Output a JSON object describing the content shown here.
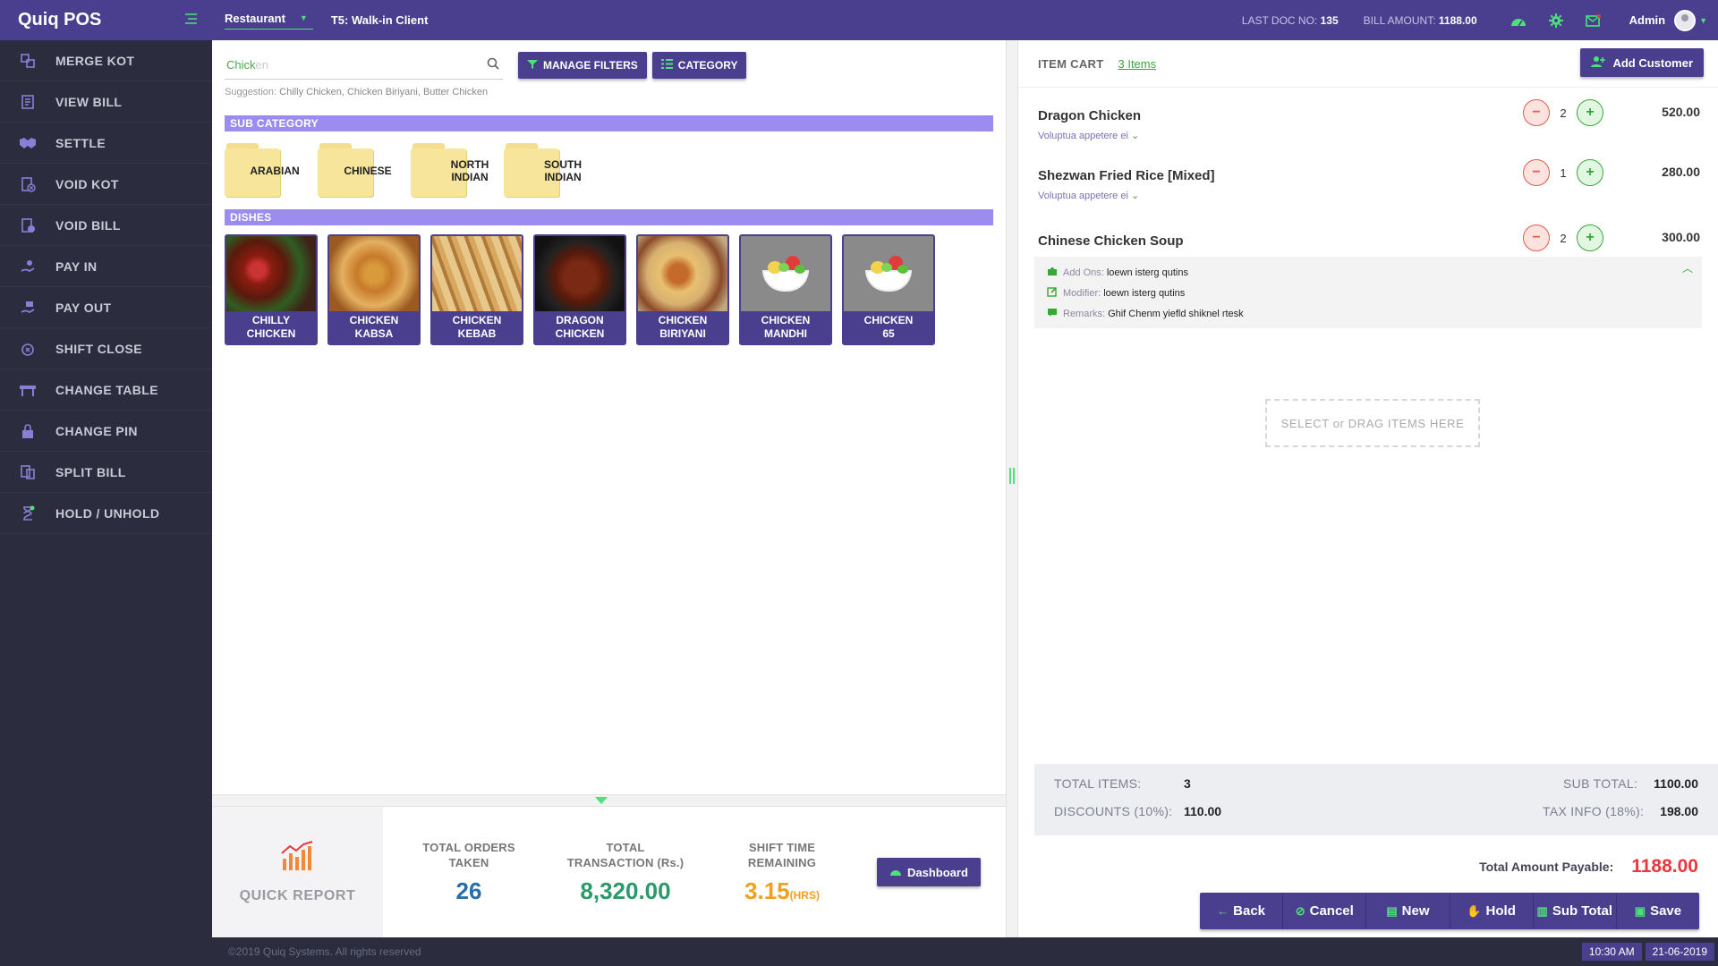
{
  "app": {
    "title": "Quiq POS"
  },
  "sidebar": {
    "items": [
      {
        "label": "MERGE KOT",
        "icon": "merge-icon"
      },
      {
        "label": "VIEW BILL",
        "icon": "bill-icon"
      },
      {
        "label": "SETTLE",
        "icon": "handshake-icon"
      },
      {
        "label": "VOID KOT",
        "icon": "void-kot-icon"
      },
      {
        "label": "VOID BILL",
        "icon": "void-bill-icon"
      },
      {
        "label": "PAY IN",
        "icon": "pay-in-icon"
      },
      {
        "label": "PAY OUT",
        "icon": "pay-out-icon"
      },
      {
        "label": "SHIFT CLOSE",
        "icon": "shift-close-icon"
      },
      {
        "label": "CHANGE TABLE",
        "icon": "table-icon"
      },
      {
        "label": "CHANGE PIN",
        "icon": "lock-icon"
      },
      {
        "label": "SPLIT BILL",
        "icon": "split-icon"
      },
      {
        "label": "HOLD / UNHOLD",
        "icon": "hourglass-icon"
      }
    ]
  },
  "topbar": {
    "mode": "Restaurant",
    "client": "T5: Walk-in Client",
    "last_doc_label": "LAST DOC NO:",
    "last_doc_value": "135",
    "bill_amount_label": "BILL AMOUNT:",
    "bill_amount_value": "1188.00",
    "user": "Admin"
  },
  "search": {
    "value": "Chick",
    "placeholder": "Chicken",
    "manage_filters": "MANAGE FILTERS",
    "category": "CATEGORY",
    "suggestion_label": "Suggestion:",
    "suggestion_text": "Chilly Chicken, Chicken Biriyani, Butter Chicken"
  },
  "sub_category": {
    "title": "SUB CATEGORY",
    "items": [
      {
        "label": "ARABIAN"
      },
      {
        "label": "CHINESE"
      },
      {
        "label": "NORTH INDIAN"
      },
      {
        "label": "SOUTH INDIAN"
      }
    ]
  },
  "dishes": {
    "title": "DISHES",
    "items": [
      {
        "label": "CHILLY CHICKEN"
      },
      {
        "label": "CHICKEN KABSA"
      },
      {
        "label": "CHICKEN KEBAB"
      },
      {
        "label": "DRAGON CHICKEN"
      },
      {
        "label": "CHICKEN BIRIYANI"
      },
      {
        "label": "CHICKEN MANDHI"
      },
      {
        "label": "CHICKEN 65"
      }
    ]
  },
  "quick_report": {
    "title": "QUICK REPORT",
    "orders_label": "TOTAL ORDERS TAKEN",
    "orders_value": "26",
    "transaction_label": "TOTAL TRANSACTION (Rs.)",
    "transaction_value": "8,320.00",
    "shift_label": "SHIFT TIME REMAINING",
    "shift_value": "3.15",
    "shift_unit": "(HRS)",
    "dashboard": "Dashboard"
  },
  "cart": {
    "title": "ITEM CART",
    "count": "3 Items",
    "add_customer": "Add Customer",
    "items": [
      {
        "name": "Dragon Chicken",
        "sub": "Voluptua appetere ei",
        "qty": "2",
        "price": "520.00"
      },
      {
        "name": "Shezwan Fried Rice [Mixed]",
        "sub": "Voluptua appetere ei",
        "qty": "1",
        "price": "280.00"
      },
      {
        "name": "Chinese Chicken Soup",
        "sub": "",
        "qty": "2",
        "price": "300.00"
      }
    ],
    "details": {
      "addons_label": "Add Ons:",
      "addons_value": "loewn isterg qutins",
      "modifier_label": "Modifier:",
      "modifier_value": "loewn isterg qutins",
      "remarks_label": "Remarks:",
      "remarks_value": "Ghif Chenm yiefld shiknel rtesk"
    },
    "drop_zone": "SELECT or DRAG ITEMS HERE"
  },
  "summary": {
    "total_items_label": "TOTAL ITEMS:",
    "total_items_value": "3",
    "discounts_label": "DISCOUNTS (10%):",
    "discounts_value": "110.00",
    "sub_total_label": "SUB TOTAL:",
    "sub_total_value": "1100.00",
    "tax_label": "TAX INFO (18%):",
    "tax_value": "198.00",
    "payable_label": "Total Amount Payable:",
    "payable_value": "1188.00"
  },
  "actions": {
    "back": "Back",
    "cancel": "Cancel",
    "new": "New",
    "hold": "Hold",
    "sub_total": "Sub Total",
    "save": "Save"
  },
  "footer": {
    "copyright": "©2019 Quiq Systems. All rights reserved",
    "time": "10:30 AM",
    "date": "21-06-2019"
  },
  "colors": {
    "primary": "#4a3f8f",
    "accent": "#4ee07a",
    "sidebar": "#2b2d3e",
    "bar": "#9d8cf0",
    "total": "#e8373f"
  }
}
